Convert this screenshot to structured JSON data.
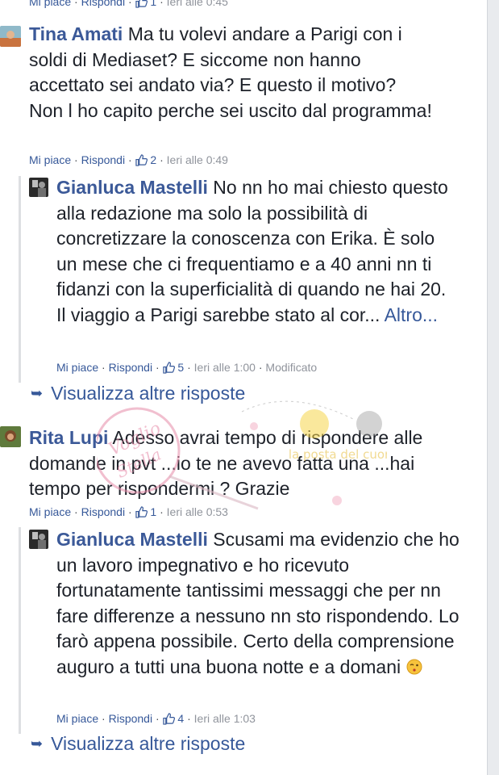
{
  "top_meta": {
    "like": "Mi piace",
    "reply": "Rispondi",
    "count": "1",
    "time": "Ieri alle 0:45"
  },
  "comments": [
    {
      "author": "Tina Amati",
      "text": "Ma tu volevi andare a Parigi con i soldi di Mediaset? E siccome non hanno accettato sei andato via? E questo il motivo? Non l ho capito perche sei uscito dal programma!",
      "like": "Mi piace",
      "reply": "Rispondi",
      "count": "2",
      "time": "Ieri alle 0:49"
    },
    {
      "author": "Gianluca Mastelli",
      "text": "No nn ho mai chiesto questo alla redazione ma solo la possibilità di concretizzare la conoscenza con Erika. È solo un mese che ci frequentiamo e a 40 anni nn ti fidanzi con la superficialità di quando ne hai 20. Il viaggio a Parigi sarebbe stato al cor...",
      "more_link": "Altro...",
      "like": "Mi piace",
      "reply": "Rispondi",
      "count": "5",
      "time": "Ieri alle 1:00",
      "edited": "Modificato"
    },
    {
      "author": "Rita Lupi",
      "text": "Adesso avrai tempo di rispondere alle domande in pvt ...io te ne avevo fatta una ...hai tempo per rispondermi ? Grazie",
      "like": "Mi piace",
      "reply": "Rispondi",
      "count": "1",
      "time": "Ieri alle 0:53"
    },
    {
      "author": "Gianluca Mastelli",
      "text": "Scusami ma evidenzio che ho un lavoro impegnativo e ho ricevuto fortunatamente tantissimi messaggi che per nn fare differenze a nessuno nn sto rispondendo. Lo farò appena possibile. Certo della comprensione auguro a tutti una buona notte e a domani",
      "emoji": "kiss-wink-emoji",
      "like": "Mi piace",
      "reply": "Rispondi",
      "count": "4",
      "time": "Ieri alle 1:03"
    }
  ],
  "more_replies": "Visualizza altre risposte",
  "watermark": {
    "text": "Voglio Stella",
    "site": "la posta del cuore"
  },
  "colors": {
    "author": "#3b5998",
    "link": "#365899",
    "meta": "#90949c",
    "text": "#1d2129"
  }
}
